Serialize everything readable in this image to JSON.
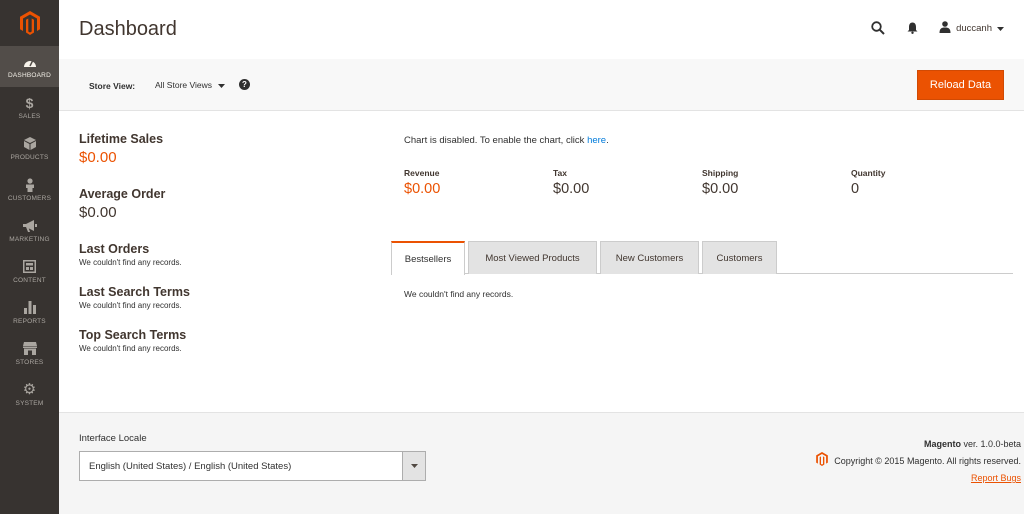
{
  "sidebar": {
    "logo_icon": "magento-logo-icon",
    "items": [
      {
        "label": "DASHBOARD",
        "icon": "speedometer-icon",
        "active": true
      },
      {
        "label": "SALES",
        "icon": "dollar-icon"
      },
      {
        "label": "PRODUCTS",
        "icon": "cube-icon"
      },
      {
        "label": "CUSTOMERS",
        "icon": "person-icon"
      },
      {
        "label": "MARKETING",
        "icon": "megaphone-icon"
      },
      {
        "label": "CONTENT",
        "icon": "layout-icon"
      },
      {
        "label": "REPORTS",
        "icon": "bar-chart-icon"
      },
      {
        "label": "STORES",
        "icon": "storefront-icon"
      },
      {
        "label": "SYSTEM",
        "icon": "gear-icon"
      }
    ]
  },
  "header": {
    "title": "Dashboard",
    "user": "duccanh"
  },
  "store_bar": {
    "label": "Store View:",
    "selected": "All Store Views",
    "help": "?",
    "reload_button": "Reload Data"
  },
  "stats": {
    "lifetime_sales": {
      "title": "Lifetime Sales",
      "value": "$0.00"
    },
    "average_order": {
      "title": "Average Order",
      "value": "$0.00"
    },
    "last_orders": {
      "title": "Last Orders",
      "empty": "We couldn't find any records."
    },
    "last_search": {
      "title": "Last Search Terms",
      "empty": "We couldn't find any records."
    },
    "top_search": {
      "title": "Top Search Terms",
      "empty": "We couldn't find any records."
    }
  },
  "chart": {
    "message": "Chart is disabled. To enable the chart, click ",
    "link": "here",
    "period": "."
  },
  "totals": [
    {
      "label": "Revenue",
      "value": "$0.00"
    },
    {
      "label": "Tax",
      "value": "$0.00"
    },
    {
      "label": "Shipping",
      "value": "$0.00"
    },
    {
      "label": "Quantity",
      "value": "0"
    }
  ],
  "tabs": [
    {
      "label": "Bestsellers",
      "active": true
    },
    {
      "label": "Most Viewed Products"
    },
    {
      "label": "New Customers"
    },
    {
      "label": "Customers"
    }
  ],
  "tab_content": "We couldn't find any records.",
  "footer": {
    "locale_label": "Interface Locale",
    "locale_value": "English (United States) / English (United States)",
    "brand": "Magento",
    "version": " ver. 1.0.0-beta",
    "copyright": "Copyright © 2015 Magento. All rights reserved.",
    "report_bugs": "Report Bugs"
  },
  "colors": {
    "accent": "#eb5202",
    "sidebar": "#373330",
    "link": "#007bdb"
  }
}
